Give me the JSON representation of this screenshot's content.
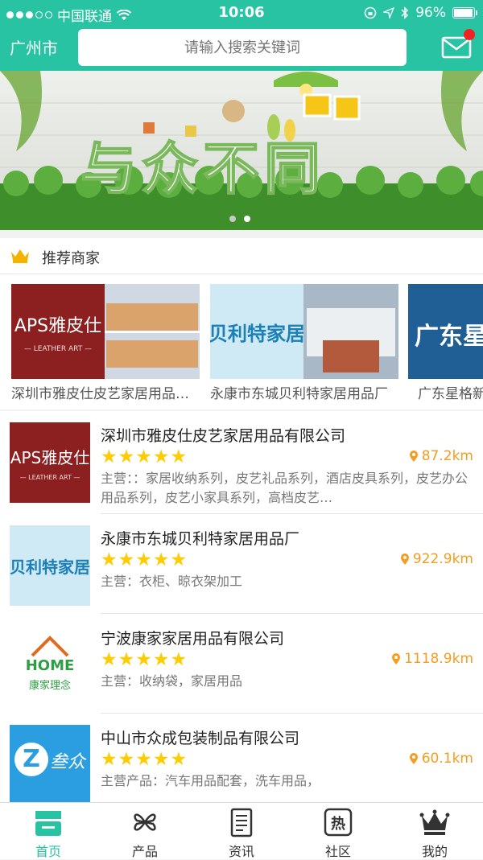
{
  "status": {
    "carrier": "中国联通",
    "time": "10:06",
    "battery": "96%"
  },
  "header": {
    "city": "广州市",
    "search_placeholder": "请输入搜索关键词"
  },
  "banner": {
    "text": "与众不同",
    "page_count": 2,
    "active_page": 2
  },
  "recommend": {
    "title": "推荐商家",
    "items": [
      {
        "name": "深圳市雅皮仕皮艺家居用品有限公司",
        "logo": "APS雅皮仕",
        "logo_sub": "— LEATHER ART —"
      },
      {
        "name": "永康市东城贝利特家居用品厂",
        "logo": "贝利特家居"
      },
      {
        "name": "广东星格新材料有限公司",
        "logo": "广东星格"
      }
    ]
  },
  "merchants": [
    {
      "name": "深圳市雅皮仕皮艺家居用品有限公司",
      "rating": 5,
      "stars": "★★★★★",
      "distance": "87.2km",
      "desc": "主营：：家居收纳系列，皮艺礼品系列，酒店皮具系列，皮艺办公用品系列，皮艺小家具系列，高档皮艺…",
      "logo": "APS雅皮仕",
      "logo_sub": "— LEATHER ART —"
    },
    {
      "name": "永康市东城贝利特家居用品厂",
      "rating": 5,
      "stars": "★★★★★",
      "distance": "922.9km",
      "desc": "主营：衣柜、晾衣架加工",
      "logo": "贝利特家居"
    },
    {
      "name": "宁波康家家居用品有限公司",
      "rating": 5,
      "stars": "★★★★★",
      "distance": "1118.9km",
      "desc": "主营：收纳袋，家居用品",
      "logo": "HOME",
      "logo_sub": "康家理念"
    },
    {
      "name": "中山市众成包装制品有限公司",
      "rating": 5,
      "stars": "★★★★★",
      "distance": "60.1km",
      "desc": "主营产品：汽车用品配套，洗车用品，",
      "logo": "Z",
      "logo_sub": "叁众"
    }
  ],
  "tabs": [
    {
      "label": "首页",
      "icon": "home-icon",
      "active": true
    },
    {
      "label": "产品",
      "icon": "clover-icon",
      "active": false
    },
    {
      "label": "资讯",
      "icon": "news-icon",
      "active": false
    },
    {
      "label": "社区",
      "icon": "hot-icon",
      "active": false
    },
    {
      "label": "我的",
      "icon": "crown-icon",
      "active": false
    }
  ],
  "colors": {
    "brand": "#28c3a3",
    "star": "#ffcc00",
    "distance": "#f59d20",
    "badge": "#f32222"
  }
}
